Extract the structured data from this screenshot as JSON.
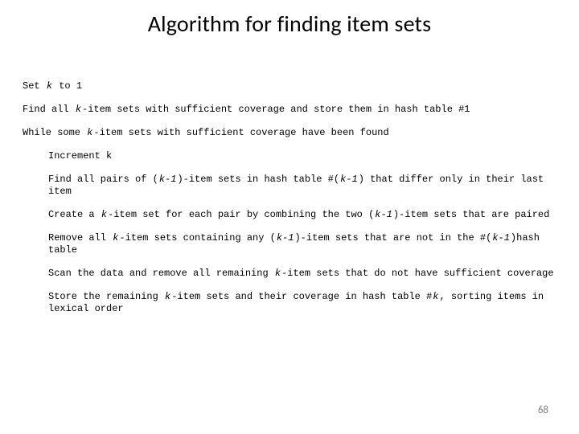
{
  "title": "Algorithm for finding item sets",
  "v": {
    "k": "k",
    "km1": "k-1"
  },
  "alg": {
    "l1a": "Set ",
    "l1b": " to 1",
    "l2a": "Find all ",
    "l2b": "-item sets with sufficient coverage and store them in hash table #1",
    "l3a": "While some ",
    "l3b": "-item sets with sufficient coverage have been found",
    "l4": "Increment k",
    "l5a": "Find all pairs of (",
    "l5b": ")-item sets in hash table #(",
    "l5c": ") that differ only in their last item",
    "l6a": "Create a ",
    "l6b": "-item set for each pair by combining the two (",
    "l6c": ")-item sets that are paired",
    "l7a": "Remove all ",
    "l7b": "-item sets containing any (",
    "l7c": ")-item sets that are not in the #(",
    "l7d": ")hash table",
    "l8a": "Scan the data and remove all remaining ",
    "l8b": "-item sets that do not have sufficient coverage",
    "l9a": "Store the remaining ",
    "l9b": "-item sets and their coverage in hash table #",
    "l9c": ", sorting items in lexical order"
  },
  "page_number": "68"
}
